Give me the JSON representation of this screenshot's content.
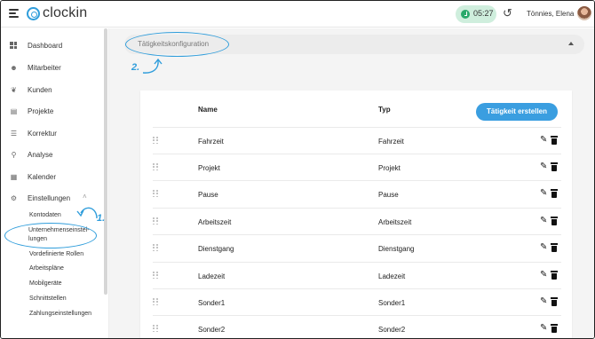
{
  "app": {
    "name": "clockin",
    "timer": "05:27",
    "user": "Tönnies, Elena"
  },
  "sidebar": {
    "items": [
      {
        "label": "Dashboard",
        "icon": "dashboard-icon"
      },
      {
        "label": "Mitarbeiter",
        "icon": "people-icon"
      },
      {
        "label": "Kunden",
        "icon": "handshake-icon"
      },
      {
        "label": "Projekte",
        "icon": "clipboard-icon"
      },
      {
        "label": "Korrektur",
        "icon": "edit-list-icon"
      },
      {
        "label": "Analyse",
        "icon": "magnifier-icon"
      },
      {
        "label": "Kalender",
        "icon": "calendar-icon"
      },
      {
        "label": "Einstellungen",
        "icon": "gear-icon"
      }
    ],
    "sub_items": [
      "Kontodaten",
      "Unternehmenseinstel-\nlungen",
      "Vordefinierte Rollen",
      "Arbeitspläne",
      "Mobilgeräte",
      "Schnittstellen",
      "Zahlungseinstellungen"
    ]
  },
  "annotations": {
    "step1": "1.",
    "step2": "2.",
    "color": "#2f9ddb"
  },
  "main": {
    "section_title": "Tätigkeitskonfiguration",
    "columns": {
      "name": "Name",
      "type": "Typ"
    },
    "create_button": "Tätigkeit erstellen",
    "rows": [
      {
        "name": "Fahrzeit",
        "type": "Fahrzeit"
      },
      {
        "name": "Projekt",
        "type": "Projekt"
      },
      {
        "name": "Pause",
        "type": "Pause"
      },
      {
        "name": "Arbeitszeit",
        "type": "Arbeitszeit"
      },
      {
        "name": "Dienstgang",
        "type": "Dienstgang"
      },
      {
        "name": "Ladezeit",
        "type": "Ladezeit"
      },
      {
        "name": "Sonder1",
        "type": "Sonder1"
      },
      {
        "name": "Sonder2",
        "type": "Sonder2"
      }
    ]
  },
  "colors": {
    "accent": "#2f9ddb",
    "button": "#3a9ee0",
    "timer_bg": "#cfeedd",
    "timer_icon": "#2aa96b"
  }
}
